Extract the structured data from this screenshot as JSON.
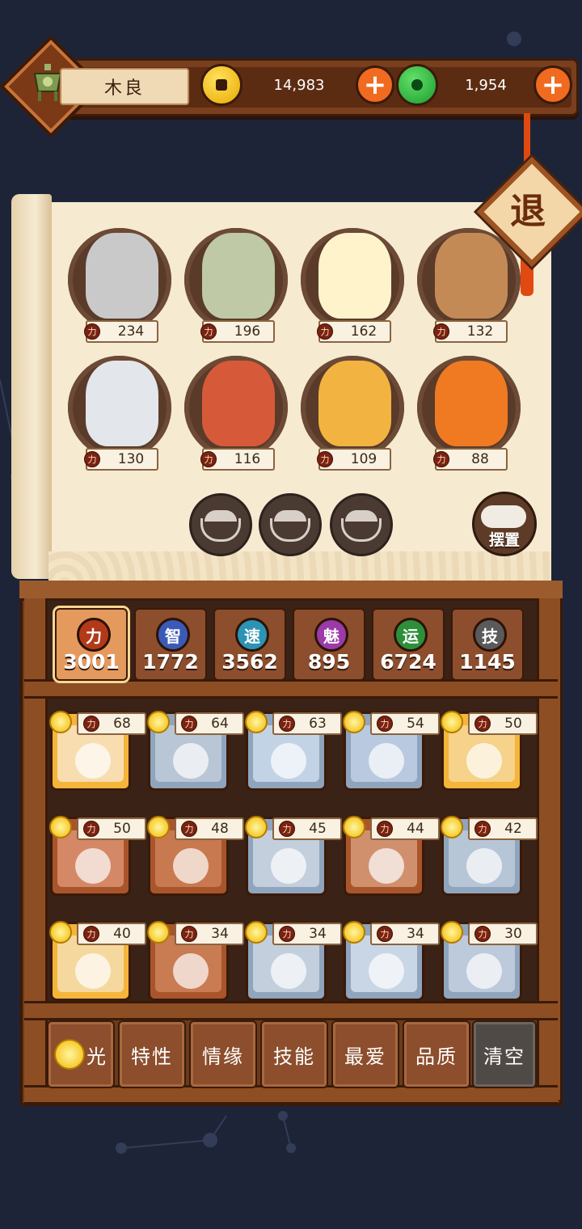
{
  "header": {
    "player_name": "木良",
    "gold_amount": "14,983",
    "jade_amount": "1,954",
    "avatar_icon": "bronze-vessel-icon",
    "gold_icon": "gold-coin-icon",
    "jade_icon": "jade-coin-icon",
    "add_icon": "plus-icon"
  },
  "retreat_label": "退",
  "team": [
    {
      "name": "silver-hair-warrior",
      "power": "234",
      "color": "#c9c9c9"
    },
    {
      "name": "money-bag-god",
      "power": "196",
      "color": "#bfc9a6"
    },
    {
      "name": "egg-twins",
      "power": "162",
      "color": "#fff3cc"
    },
    {
      "name": "crowned-cake-girl",
      "power": "132",
      "color": "#c48a56"
    },
    {
      "name": "tiger-general",
      "power": "130",
      "color": "#e3e6ea"
    },
    {
      "name": "mushroom-boy",
      "power": "116",
      "color": "#d65a3a"
    },
    {
      "name": "lotus-buddha",
      "power": "109",
      "color": "#f2b340"
    },
    {
      "name": "fire-spirit",
      "power": "88",
      "color": "#f07a22"
    }
  ],
  "empty_slots": 3,
  "arrange_label": "摆置",
  "attributes": [
    {
      "icon_char": "力",
      "value": "3001",
      "color": "#b23a1a",
      "active": true
    },
    {
      "icon_char": "智",
      "value": "1772",
      "color": "#3b5ab8",
      "active": false
    },
    {
      "icon_char": "速",
      "value": "3562",
      "color": "#2d93b5",
      "active": false
    },
    {
      "icon_char": "魅",
      "value": "895",
      "color": "#9b3aa8",
      "active": false
    },
    {
      "icon_char": "运",
      "value": "6724",
      "color": "#2e8f3a",
      "active": false
    },
    {
      "icon_char": "技",
      "value": "1145",
      "color": "#5a5a5a",
      "active": false
    }
  ],
  "power_icon_char": "力",
  "cards": [
    {
      "power": "68",
      "frame": "gold",
      "bg": "#f7ddb0"
    },
    {
      "power": "64",
      "frame": "blue",
      "bg": "#b9c6d6"
    },
    {
      "power": "63",
      "frame": "blue",
      "bg": "#c3d3e6"
    },
    {
      "power": "54",
      "frame": "blue",
      "bg": "#b9c9e0"
    },
    {
      "power": "50",
      "frame": "gold",
      "bg": "#f6d28a"
    },
    {
      "power": "50",
      "frame": "brown",
      "bg": "#d48866"
    },
    {
      "power": "48",
      "frame": "brown",
      "bg": "#c9794f"
    },
    {
      "power": "45",
      "frame": "blue",
      "bg": "#c3cfdd"
    },
    {
      "power": "44",
      "frame": "brown",
      "bg": "#d0906e"
    },
    {
      "power": "42",
      "frame": "blue",
      "bg": "#b7c6d7"
    },
    {
      "power": "40",
      "frame": "gold",
      "bg": "#f5d89d"
    },
    {
      "power": "34",
      "frame": "brown",
      "bg": "#c97b52"
    },
    {
      "power": "34",
      "frame": "blue",
      "bg": "#c3cfdd"
    },
    {
      "power": "34",
      "frame": "blue",
      "bg": "#c9d6e5"
    },
    {
      "power": "30",
      "frame": "blue",
      "bg": "#bccadb"
    }
  ],
  "filters": {
    "light": "光",
    "traits": "特性",
    "bond": "情缘",
    "skills": "技能",
    "favorite": "最爱",
    "quality": "品质",
    "clear": "清空"
  }
}
